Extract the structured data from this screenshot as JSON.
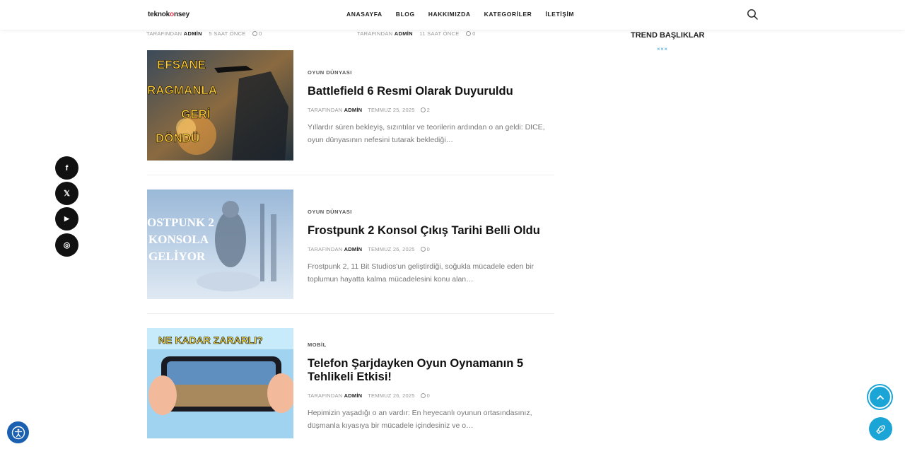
{
  "header": {
    "logo_a": "teknok",
    "logo_b": "o",
    "logo_c": "nsey",
    "nav": [
      "ANASAYFA",
      "BLOG",
      "HAKKIMIZDA",
      "KATEGORİLER",
      "İLETİŞİM"
    ]
  },
  "top_meta": [
    {
      "by": "TARAFINDAN",
      "author": "ADMİN",
      "time": "5 SAAT ÖNCE",
      "comments": "0"
    },
    {
      "by": "TARAFINDAN",
      "author": "ADMİN",
      "time": "11 SAAT ÖNCE",
      "comments": "0"
    }
  ],
  "sidebar": {
    "trend_title": "TREND BAŞLIKLAR",
    "trend_mark": "×××"
  },
  "articles": [
    {
      "category": "OYUN DÜNYASI",
      "title": "Battlefield 6 Resmi Olarak Duyuruldu",
      "by": "TARAFINDAN",
      "author": "ADMİN",
      "date": "TEMMUZ 25, 2025",
      "comments": "2",
      "excerpt": "Yıllardır süren bekleyiş, sızıntılar ve teorilerin ardından o an geldi: DICE, oyun dünyasının nefesini tutarak beklediği…",
      "thumb_text": [
        "EFSANE",
        "RAGMANLA",
        "GERİ",
        "DÖNDÜ"
      ]
    },
    {
      "category": "OYUN DÜNYASI",
      "title": "Frostpunk 2 Konsol Çıkış Tarihi Belli Oldu",
      "by": "TARAFINDAN",
      "author": "ADMİN",
      "date": "TEMMUZ 26, 2025",
      "comments": "0",
      "excerpt": "Frostpunk 2, 11 Bit Studios'un geliştirdiği, soğukla mücadele eden bir toplumun hayatta kalma mücadelesini konu alan…",
      "thumb_text": [
        "OSTPUNK 2",
        "KONSOLA",
        "GELİYOR"
      ]
    },
    {
      "category": "MOBİL",
      "title": "Telefon Şarjdayken Oyun Oynamanın 5 Tehlikeli Etkisi!",
      "by": "TARAFINDAN",
      "author": "ADMİN",
      "date": "TEMMUZ 26, 2025",
      "comments": "0",
      "excerpt": "Hepimizin yaşadığı o an vardır: En heyecanlı oyunun ortasındasınız, düşmanla kıyasıya bir mücadele içindesiniz ve o…",
      "thumb_text": [
        "NE KADAR ZARARLI?"
      ]
    }
  ],
  "social": [
    "f",
    "𝕏",
    "▶",
    "◎"
  ]
}
